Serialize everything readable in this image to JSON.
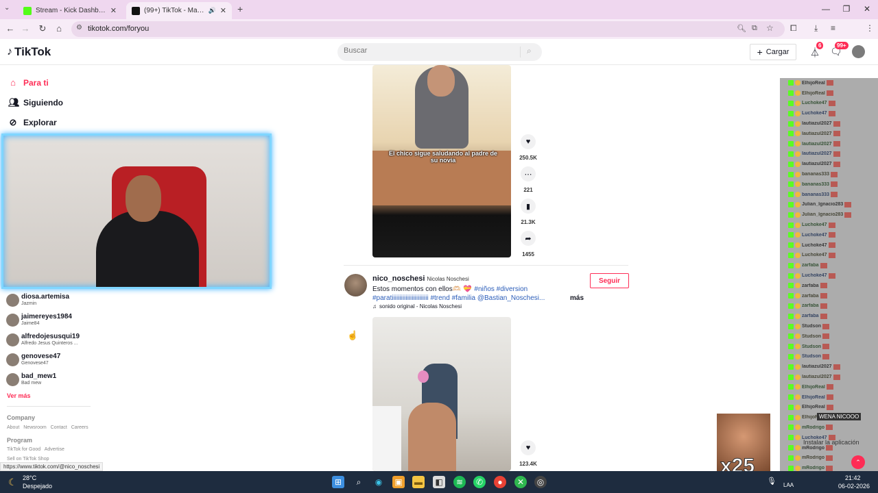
{
  "browser": {
    "tabs": [
      {
        "title": "Stream - Kick Dashboard",
        "active": false
      },
      {
        "title": "(99+) TikTok - Make Your Day",
        "active": true
      }
    ],
    "url": "tikotok.com/foryou",
    "status_url": "https://www.tiktok.com/@nico_noschesi"
  },
  "header": {
    "logo": "TikTok",
    "search_placeholder": "Buscar",
    "upload_label": "Cargar",
    "inbox_badge": "6",
    "messages_badge": "99+"
  },
  "sidebar": {
    "nav": [
      {
        "label": "Para ti",
        "icon": "home-icon",
        "active": true
      },
      {
        "label": "Siguiendo",
        "icon": "following-icon",
        "active": false
      },
      {
        "label": "Explorar",
        "icon": "compass-icon",
        "active": false
      }
    ],
    "accounts": [
      {
        "username": "diosa.artemisa",
        "display": "Jazmin"
      },
      {
        "username": "jaimereyes1984",
        "display": "Jaime84"
      },
      {
        "username": "alfredojesusqui19",
        "display": "Alfredo Jesus Quinteros ..."
      },
      {
        "username": "genovese47",
        "display": "Genovese47"
      },
      {
        "username": "bad_mew1",
        "display": "Bad mew"
      }
    ],
    "see_more": "Ver más",
    "footer": {
      "company_title": "Company",
      "company_links": [
        "About",
        "Newsroom",
        "Contact",
        "Careers"
      ],
      "program_title": "Program",
      "program_links": [
        "TikTok for Good",
        "Advertise"
      ],
      "more_link": "Sell on TikTok Shop"
    }
  },
  "feed": {
    "video1": {
      "caption_overlay": "El chico sigue saludando al padre de su novia",
      "likes": "250.5K",
      "comments": "221",
      "saves": "21.3K",
      "shares": "1455"
    },
    "video2": {
      "author_username": "nico_noschesi",
      "author_name": "Nicolas Noschesi",
      "follow_label": "Seguir",
      "description_line1": "Estos momentos con ellos🫶🏻 💝",
      "tags_line1": "#niños #diversion",
      "tags_line2": "#paratiiiiiiiiiiiiiiiiiiiiiiii #trend #familia @Bastian_Noschesi...",
      "more": "más",
      "sound": "sonido original - Nicolas Noschesi",
      "likes": "123.4K"
    }
  },
  "overlay": {
    "chat_names": [
      "ElhijoReal",
      "ElhijoReal",
      "Luchoke47",
      "Luchoke47",
      "lautiazul2027",
      "lautiazul2027",
      "lautiazul2027",
      "lautiazul2027",
      "lautiazul2027",
      "bananas333",
      "bananas333",
      "bananas333",
      "Julian_lgnacio283",
      "Julian_lgnacio283",
      "Luchoke47",
      "Luchoke47",
      "Luchoke47",
      "Luchoke47",
      "zarfaba",
      "Luchoke47",
      "zarfaba",
      "zarfaba",
      "zarfaba",
      "zarfaba",
      "Studson",
      "Studson",
      "Studson",
      "Studson",
      "lautiazul2027",
      "lautiazul2027",
      "ElhijoReal",
      "ElhijoReal",
      "ElhijoReal",
      "ElhijoReal",
      "mRodrigo",
      "Luchoke47",
      "mRodrigo",
      "mRodrigo",
      "mRodrigo",
      "mRodrigo"
    ],
    "wena": "WENA NICOOO",
    "multiplier": "x25",
    "install_app": "Instalar la aplicación"
  },
  "taskbar": {
    "temperature": "28°C",
    "weather": "Despejado",
    "lang": "LAA",
    "time": "21:42",
    "date": "06-02-2026"
  }
}
